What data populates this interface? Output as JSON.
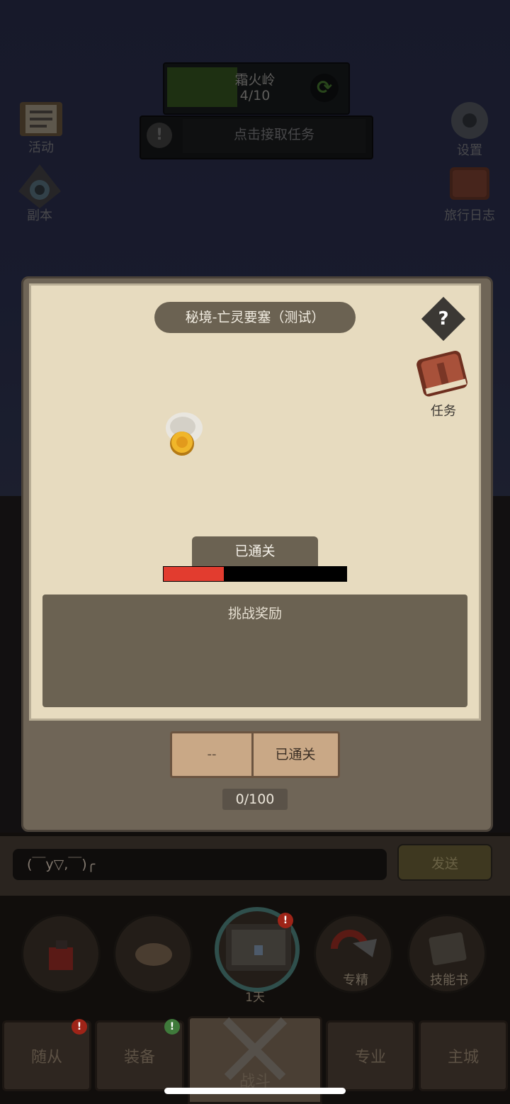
{
  "zone": {
    "name": "霜火岭",
    "count": "4/10",
    "progress_fraction": 0.4
  },
  "quest_bar": {
    "text": "点击接取任务",
    "icon": "!"
  },
  "side_left": [
    {
      "label": "活动",
      "icon": "scroll-icon"
    },
    {
      "label": "副本",
      "icon": "portal-icon"
    }
  ],
  "side_right": [
    {
      "label": "设置",
      "icon": "gear-icon"
    },
    {
      "label": "旅行日志",
      "icon": "journal-icon"
    }
  ],
  "modal": {
    "title": "秘境-亡灵要塞（测试）",
    "help": "?",
    "task_label": "任务",
    "status_banner": "已通关",
    "hp_fraction": 0.33,
    "reward_title": "挑战奖励",
    "btn_left": "--",
    "btn_right": "已通关",
    "counter": "0/100"
  },
  "chat": {
    "input_value": "(￣y▽,￣)╭",
    "send_label": "发送"
  },
  "skills": {
    "special_label": "专精",
    "skillbook_label": "技能书",
    "day_label": "1天"
  },
  "tabs": [
    {
      "label": "随从"
    },
    {
      "label": "装备"
    },
    {
      "label": "战斗"
    },
    {
      "label": "专业"
    },
    {
      "label": "主城"
    }
  ],
  "colors": {
    "hp_red": "#e23c2f",
    "zone_green": "#2f4a1c",
    "parchment": "#e7dbbf"
  }
}
